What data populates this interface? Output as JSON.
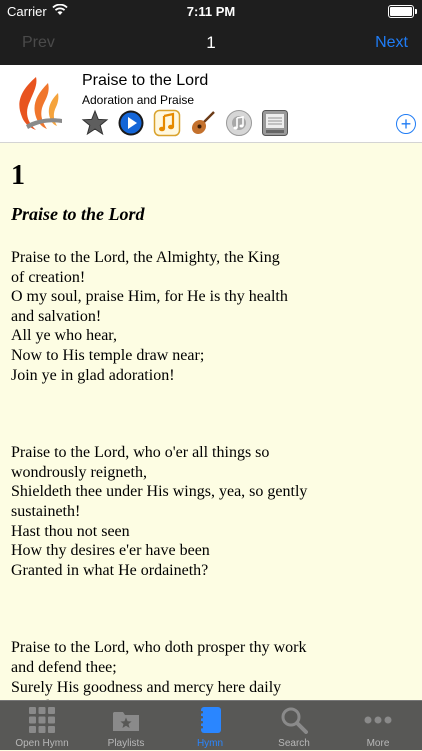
{
  "status_bar": {
    "carrier": "Carrier",
    "time": "7:11 PM"
  },
  "navbar": {
    "prev": "Prev",
    "title": "1",
    "next": "Next"
  },
  "header": {
    "title": "Praise to the Lord",
    "category": "Adoration and Praise",
    "icons": [
      "star-icon",
      "play-icon",
      "music-note-icon",
      "guitar-icon",
      "speaker-icon",
      "sheet-music-icon"
    ],
    "add_icon": "plus-circle-icon"
  },
  "hymn": {
    "number": "1",
    "title": "Praise to the Lord",
    "stanzas": [
      "Praise to the Lord, the Almighty, the King\nof creation!\nO my soul, praise Him, for He is thy health\nand salvation!\nAll ye who hear,\nNow to His temple draw near;\nJoin ye in glad adoration!",
      "Praise to the Lord, who o'er all things so\nwondrously reigneth,\nShieldeth thee under His wings, yea, so gently\nsustaineth!\nHast thou not seen\nHow thy desires e'er have been\nGranted in what He ordaineth?",
      "Praise to the Lord, who doth prosper thy work\nand defend thee;\nSurely His goodness and mercy here daily\nattend thee."
    ]
  },
  "tabs": [
    {
      "label": "Open Hymn",
      "icon": "grid-icon",
      "active": false
    },
    {
      "label": "Playlists",
      "icon": "folder-star-icon",
      "active": false
    },
    {
      "label": "Hymn",
      "icon": "book-icon",
      "active": true
    },
    {
      "label": "Search",
      "icon": "search-icon",
      "active": false
    },
    {
      "label": "More",
      "icon": "more-icon",
      "active": false
    }
  ],
  "colors": {
    "accent": "#1f7cf5",
    "page_bg": "#fdfde3",
    "bar_bg": "#1e1e1e",
    "tabbar_bg": "#585856"
  }
}
